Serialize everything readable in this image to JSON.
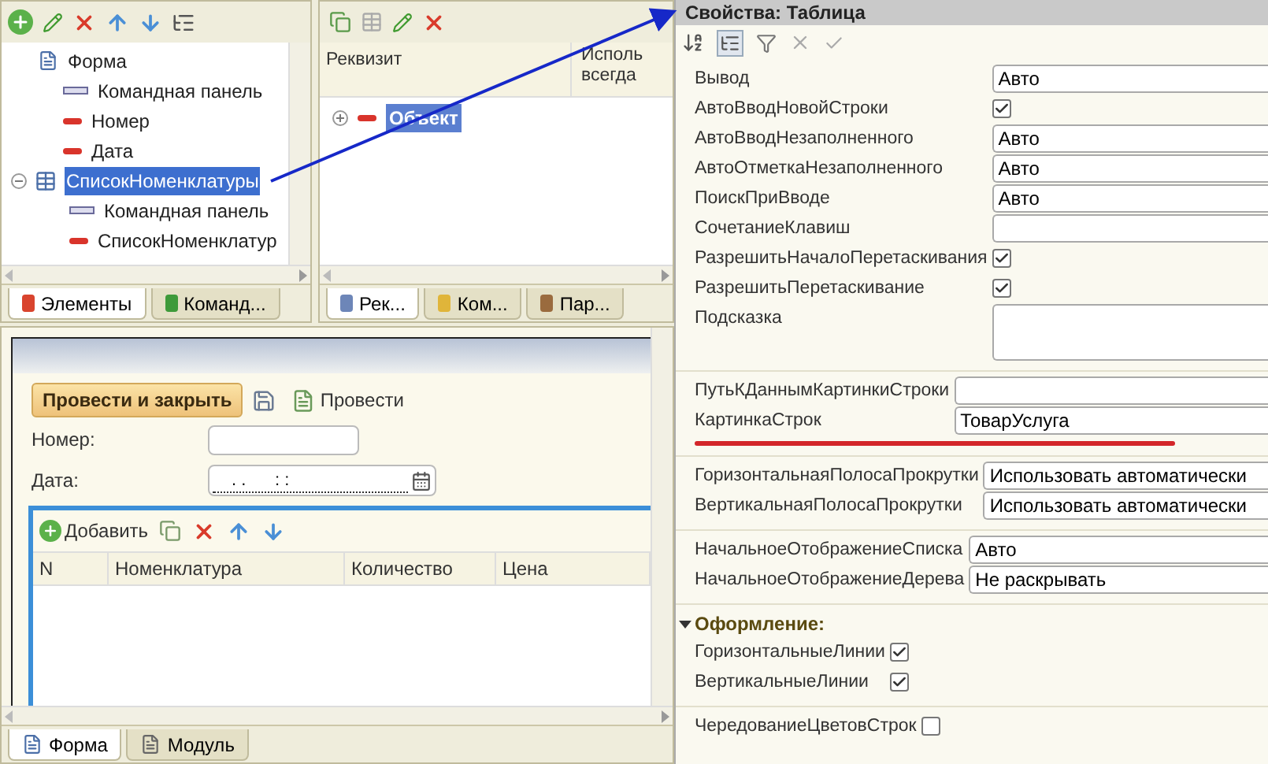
{
  "elements_panel": {
    "tree": [
      {
        "label": "Форма",
        "kind": "form",
        "selected": false
      },
      {
        "label": "Командная панель",
        "kind": "command-bar",
        "selected": false,
        "indent": true
      },
      {
        "label": "Номер",
        "kind": "field",
        "selected": false,
        "indent": true
      },
      {
        "label": "Дата",
        "kind": "field",
        "selected": false,
        "indent": true
      },
      {
        "label": "СписокНоменклатуры",
        "kind": "table",
        "selected": true,
        "expanded": true,
        "children": [
          {
            "label": "Командная панель",
            "kind": "command-bar",
            "selected": false
          },
          {
            "label": "СписокНоменклатур",
            "kind": "field",
            "selected": false
          }
        ]
      }
    ],
    "tabs": [
      {
        "label": "Элементы",
        "color": "#d9442e",
        "selected": true
      },
      {
        "label": "Команд...",
        "color": "#3e9a3a",
        "selected": false
      }
    ]
  },
  "attributes_panel": {
    "columns": [
      "Реквизит",
      "Исполь\nвсегда"
    ],
    "tree": [
      {
        "label": "Объект",
        "selected": true,
        "expanded": false
      }
    ],
    "tabs": [
      {
        "label": "Рек...",
        "color": "#6d86b8",
        "selected": true
      },
      {
        "label": "Ком...",
        "color": "#e0b53a",
        "selected": false
      },
      {
        "label": "Пар...",
        "color": "#9a6b3e",
        "selected": false
      }
    ]
  },
  "form_preview": {
    "buttons": [
      {
        "label": "Провести и закрыть",
        "kind": "default"
      },
      {
        "kind": "save"
      },
      {
        "label": "Провести",
        "kind": "post"
      }
    ],
    "fields": [
      {
        "label": "Номер:",
        "kind": "text"
      },
      {
        "label": "Дата:",
        "kind": "date",
        "value": ". .      : :"
      }
    ],
    "table": {
      "add_label": "Добавить",
      "columns": [
        "N",
        "Номенклатура",
        "Количество",
        "Цена"
      ]
    },
    "tabs": [
      {
        "label": "Форма",
        "selected": true
      },
      {
        "label": "Модуль",
        "selected": false
      }
    ]
  },
  "properties": {
    "title": "Свойства: Таблица",
    "groups": [
      {
        "rows": [
          {
            "name": "Вывод",
            "kind": "select",
            "value": "Авто"
          },
          {
            "name": "АвтоВводНовойСтроки",
            "kind": "checkbox",
            "checked": true
          },
          {
            "name": "АвтоВводНезаполненного",
            "kind": "select",
            "value": "Авто"
          },
          {
            "name": "АвтоОтметкаНезаполненного",
            "kind": "select",
            "value": "Авто"
          },
          {
            "name": "ПоискПриВводе",
            "kind": "select",
            "value": "Авто"
          },
          {
            "name": "СочетаниеКлавиш",
            "kind": "text"
          },
          {
            "name": "РазрешитьНачалоПеретаскивания",
            "kind": "checkbox",
            "checked": true
          },
          {
            "name": "РазрешитьПеретаскивание",
            "kind": "checkbox",
            "checked": true
          },
          {
            "name": "Подсказка",
            "kind": "textarea"
          }
        ]
      },
      {
        "underlined": true,
        "rows": [
          {
            "name": "ПутьКДаннымКартинкиСтроки",
            "kind": "text"
          },
          {
            "name": "КартинкаСтрок",
            "kind": "select",
            "value": "ТоварУслуга"
          }
        ]
      },
      {
        "rows": [
          {
            "name": "ГоризонтальнаяПолосаПрокрутки",
            "kind": "select",
            "value": "Использовать автоматически"
          },
          {
            "name": "ВертикальнаяПолосаПрокрутки",
            "kind": "select",
            "value": "Использовать автоматически"
          }
        ]
      },
      {
        "rows": [
          {
            "name": "НачальноеОтображениеСписка",
            "kind": "select",
            "value": "Авто"
          },
          {
            "name": "НачальноеОтображениеДерева",
            "kind": "select",
            "value": "Не раскрывать"
          }
        ]
      },
      {
        "title": "Оформление:",
        "expanded": true,
        "rows": [
          {
            "name": "ГоризонтальныеЛинии",
            "kind": "checkbox",
            "checked": true
          },
          {
            "name": "ВертикальныеЛинии",
            "kind": "checkbox",
            "checked": true
          }
        ]
      },
      {
        "rows": [
          {
            "name": "ЧередованиеЦветовСтрок",
            "kind": "checkbox",
            "checked": false
          }
        ]
      }
    ]
  }
}
